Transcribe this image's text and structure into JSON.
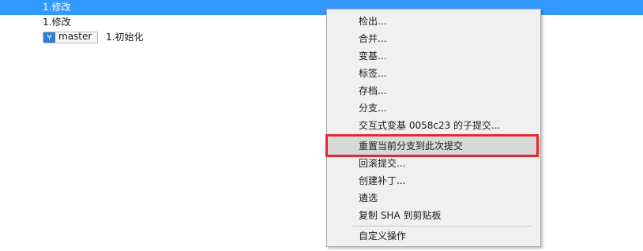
{
  "commits": [
    {
      "message": "1.修改"
    },
    {
      "message": "1.修改"
    },
    {
      "branch": "master",
      "message": "1.初始化"
    }
  ],
  "branch_icon": "branch-icon",
  "menu": {
    "items": [
      {
        "label": "检出..."
      },
      {
        "label": "合并..."
      },
      {
        "label": "变基..."
      },
      {
        "label": "标签..."
      },
      {
        "label": "存档..."
      },
      {
        "label": "分支..."
      },
      {
        "label": "交互式变基 0058c23 的子提交..."
      },
      {
        "label": "重置当前分支到此次提交"
      },
      {
        "label": "回滚提交..."
      },
      {
        "label": "创建补丁..."
      },
      {
        "label": "遴选"
      },
      {
        "label": "复制 SHA 到剪贴板"
      },
      {
        "label": "自定义操作"
      }
    ]
  },
  "colors": {
    "selection": "#3399ff",
    "highlight_border": "#e8262d",
    "branch_tag": "#2e7fd6"
  }
}
